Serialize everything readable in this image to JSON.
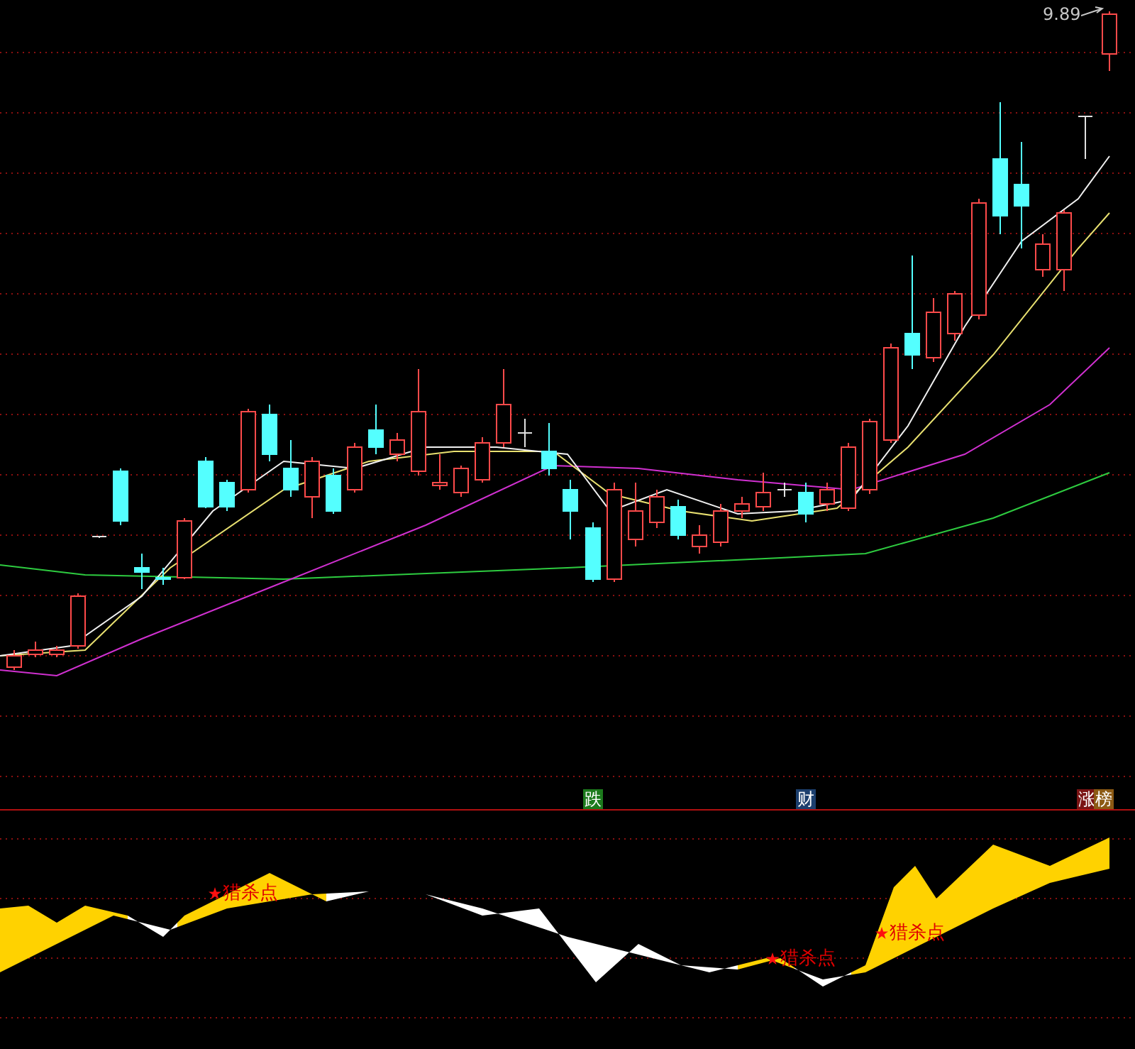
{
  "price_chart": {
    "high_label": "9.89"
  },
  "signal_tags": [
    {
      "label": "跌",
      "color": "#1c7a1c"
    },
    {
      "label": "财",
      "color": "#1c3f6e"
    },
    {
      "label": "涨",
      "color": "#7a1414"
    },
    {
      "label": "榜",
      "color": "#8c5a14"
    }
  ],
  "indicator": {
    "markers": [
      {
        "label": "猎杀点"
      },
      {
        "label": "猎杀点"
      },
      {
        "label": "猎杀点"
      }
    ]
  }
}
